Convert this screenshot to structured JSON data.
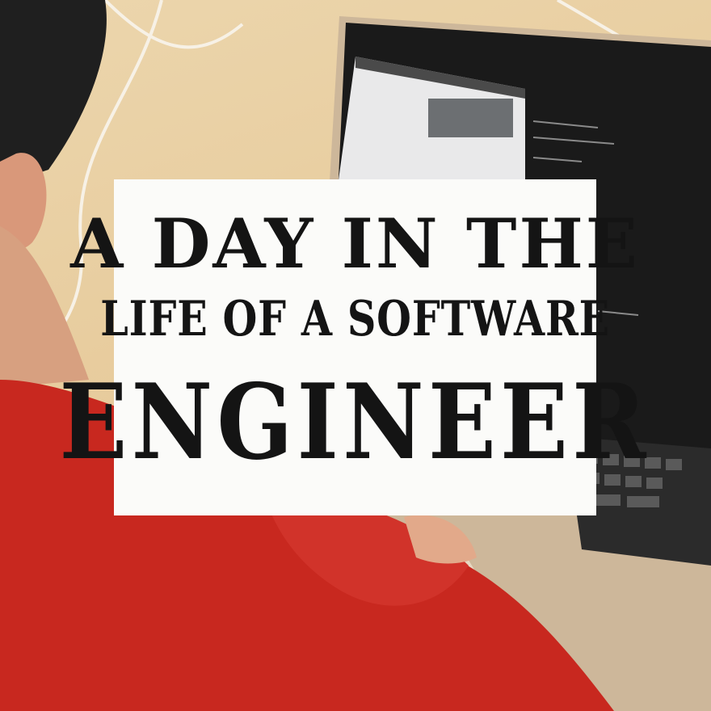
{
  "title": {
    "line1": "A Day in the",
    "line2": "Life of a Software",
    "line3": "Engineer"
  },
  "colors": {
    "background": "#e8cfa5",
    "sweater": "#c8281f",
    "laptop_screen": "#141414",
    "laptop_body": "#cdb79a",
    "card": "#fbfbf9",
    "text": "#141414"
  }
}
